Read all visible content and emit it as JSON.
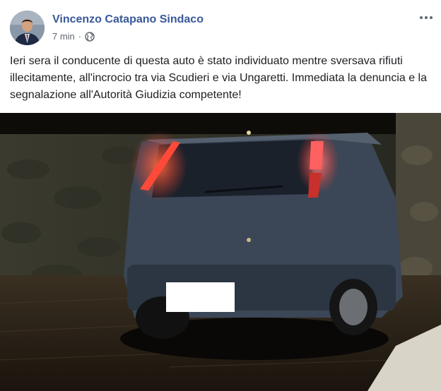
{
  "post": {
    "author": "Vincenzo Catapano Sindaco",
    "timestamp": "7 min",
    "separator": "·",
    "privacy_icon": "globe-icon",
    "more_icon": "more-horizontal-icon",
    "text": "Ieri sera il conducente di questa auto è stato individuato mentre sversava rifiuti illecitamente, all'incrocio tra via Scudieri e via Ungaretti. Immediata la denuncia e la segnalazione all'Autorità Giudizia competente!"
  },
  "colors": {
    "author_link": "#385898",
    "meta_text": "#606770",
    "body_text": "#1c1e21",
    "taillight": "#ff3b30",
    "car_body": "#3b4656"
  }
}
